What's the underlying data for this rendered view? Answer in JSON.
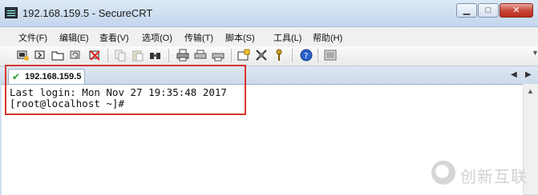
{
  "window": {
    "title": "192.168.159.5 - SecureCRT",
    "minimize_glyph": "▁",
    "maximize_glyph": "□",
    "close_glyph": "✕"
  },
  "menu": {
    "items": [
      "文件(F)",
      "编辑(E)",
      "查看(V)",
      "选项(O)",
      "传输(T)",
      "脚本(S)",
      "工具(L)",
      "帮助(H)"
    ]
  },
  "toolbar": {
    "icons": [
      "connect-icon",
      "quick-connect-icon",
      "connect-tab-icon",
      "reconnect-icon",
      "disconnect-icon",
      "copy-icon",
      "paste-icon",
      "find-icon",
      "print-icon",
      "print-setup-icon",
      "log-icon",
      "session-options-icon",
      "global-options-icon",
      "keymap-icon",
      "help-icon",
      "sftp-icon"
    ]
  },
  "tab": {
    "label": "192.168.159.5",
    "status_icon": "checkmark-icon",
    "status_color": "#2c9a2c"
  },
  "terminal": {
    "lines": [
      "Last login: Mon Nov 27 19:35:48 2017",
      "[root@localhost ~]#"
    ]
  },
  "watermark": {
    "text": "创新互联"
  },
  "colors": {
    "highlight_border": "#d9372f",
    "terminal_background": "#ffffff"
  }
}
